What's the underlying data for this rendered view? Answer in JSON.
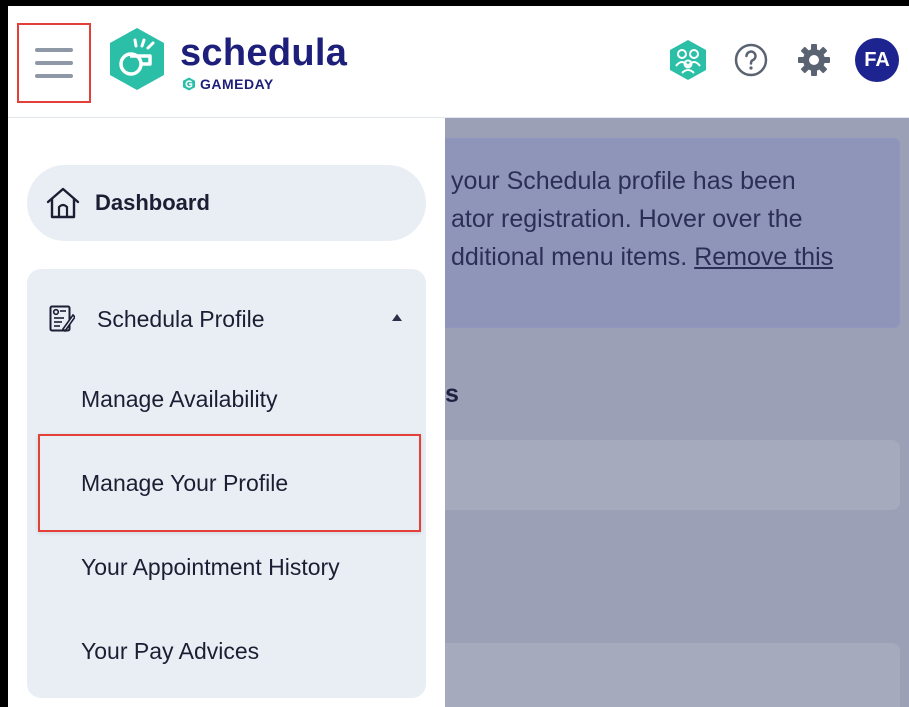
{
  "header": {
    "brand_name": "schedula",
    "brand_sub": "GAMEDAY",
    "avatar_initials": "FA",
    "icons": [
      "hamburger-menu-icon",
      "whistle-logo-icon",
      "team-icon",
      "help-icon",
      "settings-gear-icon"
    ],
    "colors": {
      "brand": "#1d1f7a",
      "logo": "#2bbfa8",
      "avatar": "#1d238f",
      "highlight": "#e4403a"
    }
  },
  "sidebar": {
    "dashboard_label": "Dashboard",
    "group_label": "Schedula Profile",
    "items": [
      {
        "label": "Manage Availability"
      },
      {
        "label": "Manage Your Profile"
      },
      {
        "label": "Your Appointment History"
      },
      {
        "label": "Your Pay Advices"
      }
    ]
  },
  "main": {
    "banner_lines": [
      "your Schedula profile has been",
      "ator registration. Hover over the",
      "dditional menu items."
    ],
    "banner_link": "Remove this",
    "heading": "s",
    "card_text": "."
  }
}
